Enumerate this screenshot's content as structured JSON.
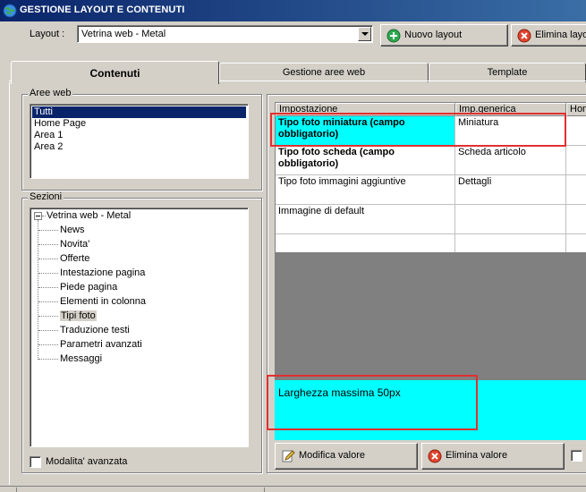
{
  "window": {
    "title": "GESTIONE LAYOUT E CONTENUTI"
  },
  "layout_bar": {
    "label": "Layout :",
    "selected": "Vetrina web - Metal",
    "new_button": "Nuovo layout",
    "delete_button": "Elimina layout"
  },
  "tabs": [
    "Contenuti",
    "Gestione aree web",
    "Template"
  ],
  "aree_web": {
    "label": "Aree web",
    "items": [
      "Tutti",
      "Home Page",
      "Area 1",
      "Area 2"
    ],
    "selected_index": 0
  },
  "sezioni": {
    "label": "Sezioni",
    "root": "Vetrina web - Metal",
    "children": [
      "News",
      "Novita'",
      "Offerte",
      "Intestazione pagina",
      "Piede pagina",
      "Elementi in colonna",
      "Tipi foto",
      "Traduzione testi",
      "Parametri avanzati",
      "Messaggi"
    ],
    "selected": "Tipi foto"
  },
  "advanced_mode": {
    "label": "Modalita' avanzata",
    "checked": false
  },
  "settings_grid": {
    "headers": [
      "Impostazione",
      "Imp.generica",
      "Hom"
    ],
    "rows": [
      {
        "name": "Tipo foto miniatura (campo obbligatorio)",
        "value": "Miniatura",
        "bold": true,
        "highlight": true
      },
      {
        "name": "Tipo foto scheda (campo obbligatorio)",
        "value": "Scheda articolo",
        "bold": true,
        "highlight": false
      },
      {
        "name": "Tipo foto immagini aggiuntive",
        "value": "Dettagli",
        "bold": false,
        "highlight": false
      },
      {
        "name": "Immagine di default",
        "value": "",
        "bold": false,
        "highlight": false
      }
    ]
  },
  "description": {
    "text": "Larghezza massima 50px"
  },
  "actions": {
    "edit_button": "Modifica valore",
    "delete_button": "Elimina valore"
  },
  "colors": {
    "highlight_cyan": "#00ffff",
    "selection_navy": "#0a246a",
    "annotation_red": "#e03030"
  }
}
